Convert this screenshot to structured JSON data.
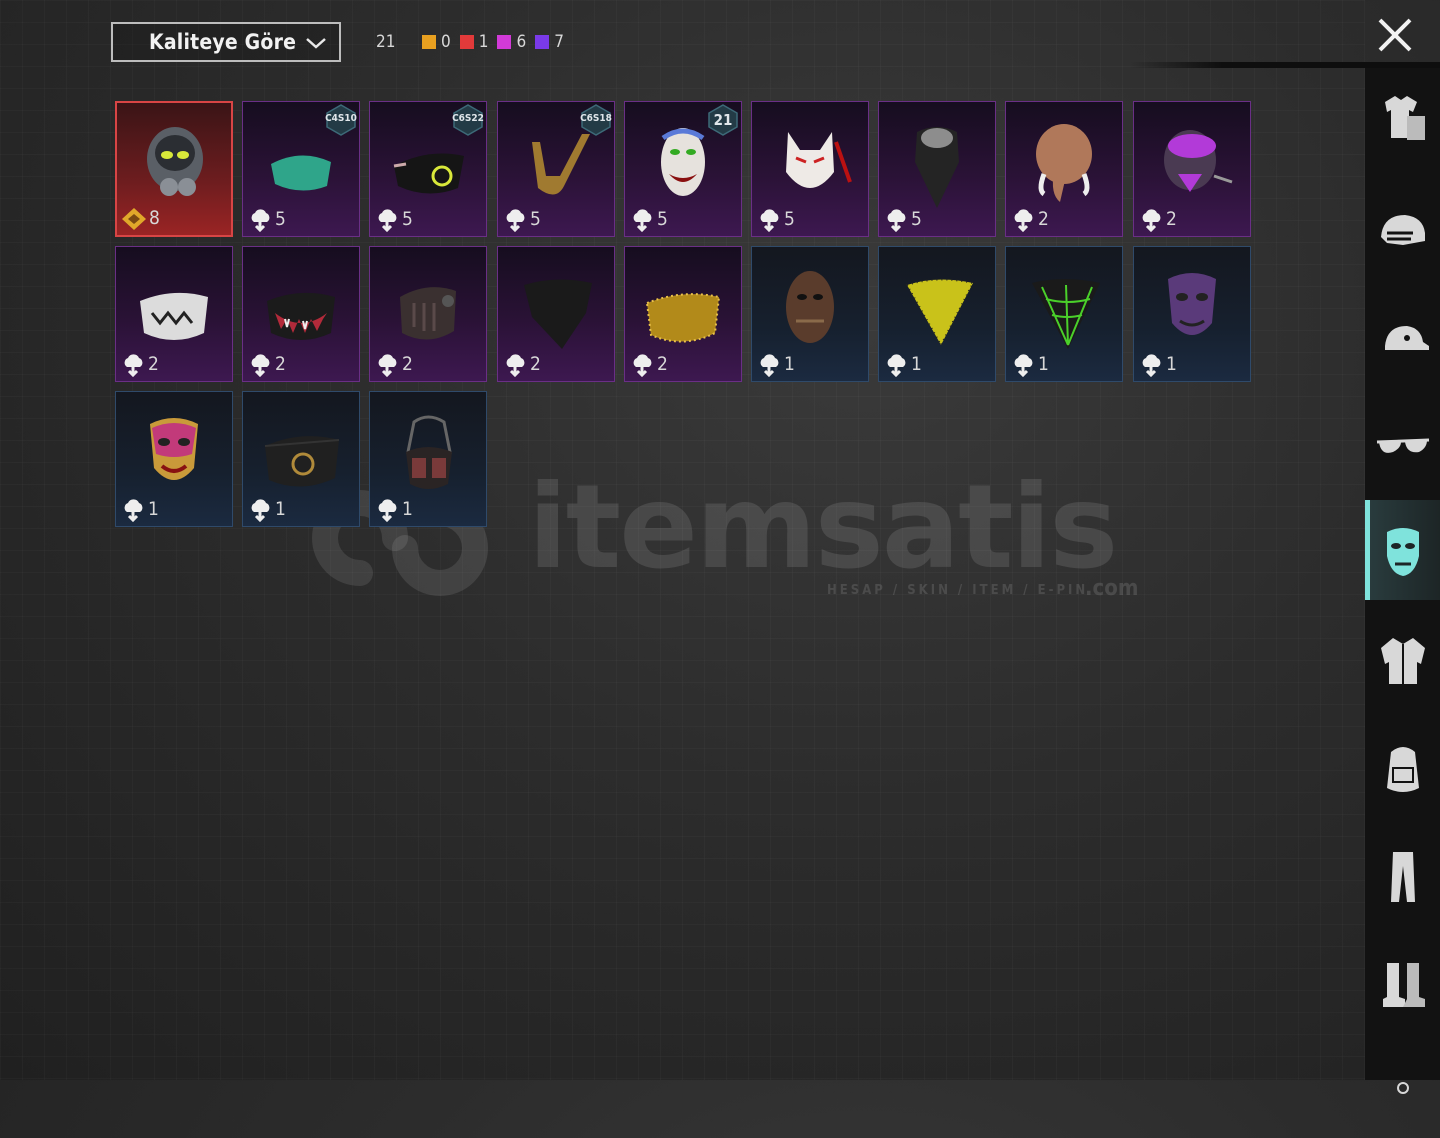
{
  "sort": {
    "label": "Kaliteye Göre"
  },
  "counts": {
    "total": "21",
    "qualities": [
      {
        "color": "#e8a020",
        "value": "0"
      },
      {
        "color": "#e23a3a",
        "value": "1"
      },
      {
        "color": "#d23ad8",
        "value": "6"
      },
      {
        "color": "#7a3ae8",
        "value": "7"
      }
    ]
  },
  "items": [
    {
      "name": "iron-gas-mask",
      "quality": "orange",
      "qty": "8",
      "badge": ""
    },
    {
      "name": "green-cloth-mask",
      "quality": "purple",
      "qty": "5",
      "badge": "C4S10"
    },
    {
      "name": "black-neon-mask",
      "quality": "purple",
      "qty": "5",
      "badge": "C6S22"
    },
    {
      "name": "golden-jaw-mask",
      "quality": "purple",
      "qty": "5",
      "badge": "C6S18"
    },
    {
      "name": "joker-mask",
      "quality": "purple",
      "qty": "5",
      "badge": "21"
    },
    {
      "name": "kitsune-mask",
      "quality": "purple",
      "qty": "5",
      "badge": ""
    },
    {
      "name": "skull-bandana",
      "quality": "purple",
      "qty": "5",
      "badge": ""
    },
    {
      "name": "mammoth-mask",
      "quality": "purple",
      "qty": "2",
      "badge": ""
    },
    {
      "name": "purple-respirator",
      "quality": "purple",
      "qty": "2",
      "badge": ""
    },
    {
      "name": "skull-face-mask",
      "quality": "purple",
      "qty": "2",
      "badge": ""
    },
    {
      "name": "fangs-face-mask",
      "quality": "purple",
      "qty": "2",
      "badge": ""
    },
    {
      "name": "armored-jaw-mask",
      "quality": "purple",
      "qty": "2",
      "badge": ""
    },
    {
      "name": "black-bandana",
      "quality": "purple",
      "qty": "2",
      "badge": ""
    },
    {
      "name": "gold-glitter-mask",
      "quality": "purple",
      "qty": "2",
      "badge": ""
    },
    {
      "name": "rusty-hockey-mask",
      "quality": "blue",
      "qty": "1",
      "badge": ""
    },
    {
      "name": "yellow-dot-bandana",
      "quality": "blue",
      "qty": "1",
      "badge": ""
    },
    {
      "name": "spiderweb-bandana",
      "quality": "blue",
      "qty": "1",
      "badge": ""
    },
    {
      "name": "purple-theater-mask",
      "quality": "blue",
      "qty": "1",
      "badge": ""
    },
    {
      "name": "pink-gold-theater-mask",
      "quality": "blue",
      "qty": "1",
      "badge": ""
    },
    {
      "name": "black-gold-emblem-mask",
      "quality": "blue",
      "qty": "1",
      "badge": ""
    },
    {
      "name": "tactical-respirator",
      "quality": "blue",
      "qty": "1",
      "badge": ""
    }
  ],
  "watermark": {
    "brand": "itemsatis",
    "tagline": "HESAP / SKIN / ITEM / E-PIN",
    "domain": ".com"
  },
  "sidebar": [
    {
      "name": "outfit-icon"
    },
    {
      "name": "helmet-icon"
    },
    {
      "name": "cap-icon"
    },
    {
      "name": "glasses-icon"
    },
    {
      "name": "mask-icon",
      "active": true
    },
    {
      "name": "jacket-icon"
    },
    {
      "name": "backpack-icon"
    },
    {
      "name": "pants-icon"
    },
    {
      "name": "boots-icon"
    },
    {
      "name": "more-icon"
    }
  ]
}
